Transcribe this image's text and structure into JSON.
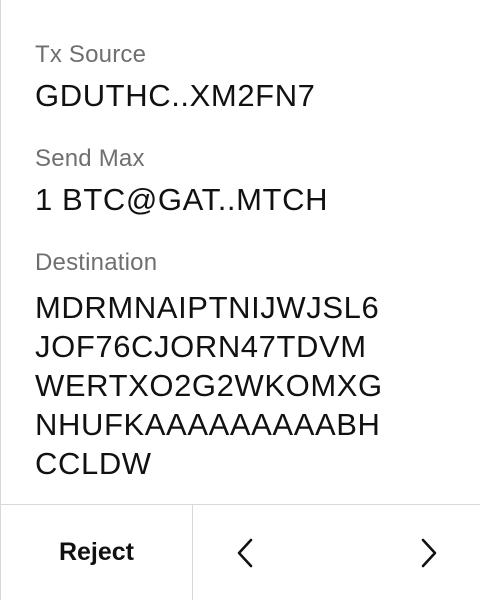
{
  "fields": {
    "tx_source": {
      "label": "Tx Source",
      "value": "GDUTHC..XM2FN7"
    },
    "send_max": {
      "label": "Send Max",
      "value": "1 BTC@GAT..MTCH"
    },
    "destination": {
      "label": "Destination",
      "lines": [
        "MDRMNAIPTNIJWJSL6",
        "JOF76CJORN47TDVM",
        "WERTXO2G2WKOMXG",
        "NHUFKAAAAAAAAABH",
        "CCLDW"
      ]
    }
  },
  "footer": {
    "reject_label": "Reject",
    "prev_icon": "chevron-left-icon",
    "next_icon": "chevron-right-icon"
  }
}
